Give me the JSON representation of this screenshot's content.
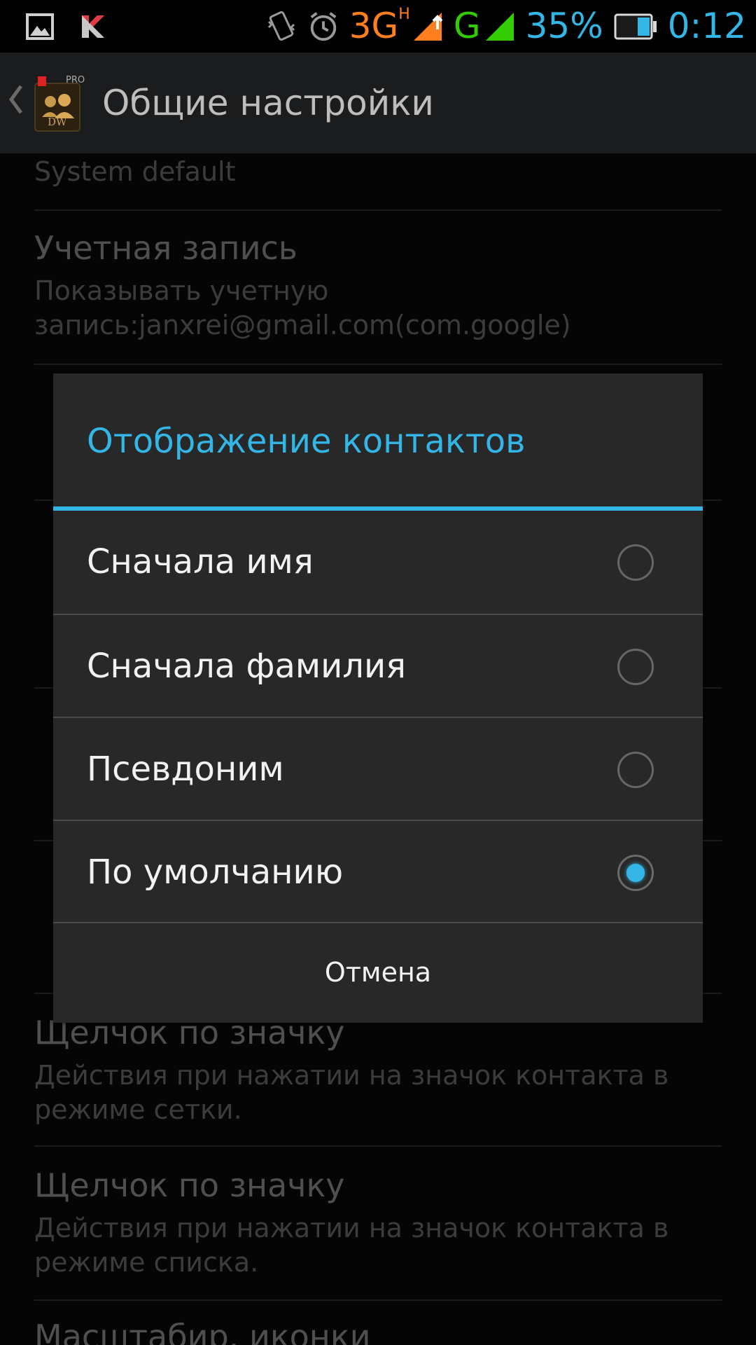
{
  "status_bar": {
    "network_3g": "3G",
    "network_h": "H",
    "network_g": "G",
    "battery_percent": "35%",
    "time": "0:12",
    "colors": {
      "orange": "#ff7f1f",
      "green": "#33cc00",
      "blue": "#33b5e5"
    }
  },
  "action_bar": {
    "title": "Общие настройки",
    "app_icon_badge": "PRO",
    "app_icon_label": "DW"
  },
  "settings": {
    "items": [
      {
        "summary": "System default"
      },
      {
        "title": "Учетная запись",
        "summary": "Показывать учетную запись:janxrei@gmail.com(com.google)"
      },
      {
        "title": "Щелчок по значку",
        "summary": "Действия при нажатии на значок контакта в режиме сетки."
      },
      {
        "title": "Щелчок по значку",
        "summary": "Действия при нажатии на значок контакта в режиме списка."
      },
      {
        "title": "Масштабир. иконки"
      }
    ]
  },
  "dialog": {
    "title": "Отображение контактов",
    "options": [
      {
        "label": "Сначала имя",
        "selected": false
      },
      {
        "label": "Сначала фамилия",
        "selected": false
      },
      {
        "label": "Псевдоним",
        "selected": false
      },
      {
        "label": "По умолчанию",
        "selected": true
      }
    ],
    "cancel_label": "Отмена",
    "accent_color": "#33b5e5"
  }
}
